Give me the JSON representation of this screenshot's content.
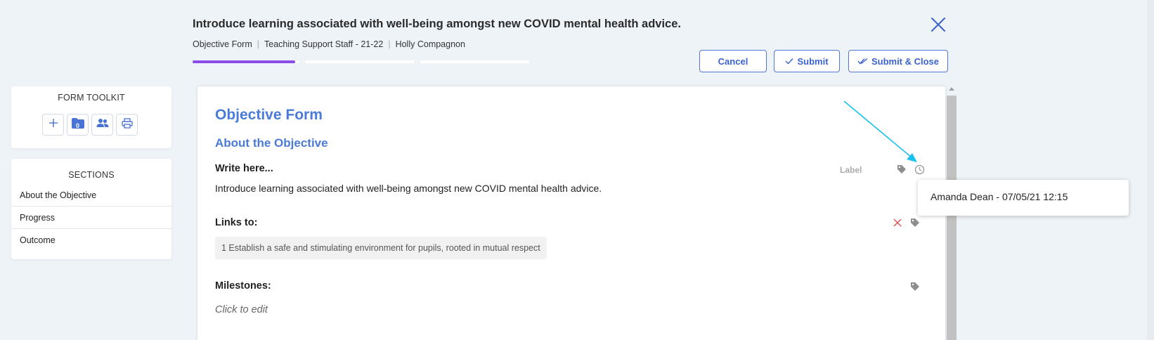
{
  "header": {
    "title": "Introduce learning associated with well-being amongst new COVID mental health advice.",
    "breadcrumb": [
      "Objective Form",
      "Teaching Support Staff - 21-22",
      "Holly Compagnon"
    ],
    "progress": [
      0.96,
      0,
      0
    ],
    "close_icon": "close-icon"
  },
  "actions": {
    "cancel": "Cancel",
    "submit": "Submit",
    "submit_close": "Submit & Close"
  },
  "toolkit": {
    "heading": "FORM TOOLKIT",
    "tools": [
      {
        "icon": "plus-icon"
      },
      {
        "icon": "folder-icon",
        "badge": "0"
      },
      {
        "icon": "people-icon"
      },
      {
        "icon": "print-icon"
      }
    ]
  },
  "sections": {
    "heading": "SECTIONS",
    "items": [
      {
        "label": "About the Objective"
      },
      {
        "label": "Progress"
      },
      {
        "label": "Outcome"
      }
    ]
  },
  "form": {
    "title": "Objective Form",
    "subtitle": "About the Objective",
    "write_label": "Write here...",
    "write_value": "Introduce learning associated with well-being amongst new COVID mental health advice.",
    "label_button": "Label",
    "links_label": "Links to:",
    "link_chip": "1 Establish a safe and stimulating environment for pupils, rooted in mutual respect",
    "milestones_label": "Milestones:",
    "milestones_placeholder": "Click to edit"
  },
  "popover": {
    "text": "Amanda Dean - 07/05/21 12:15"
  },
  "colors": {
    "accent": "#4a7bd9",
    "button_text": "#3b63d0",
    "progress": "#8a4ee8",
    "delete": "#e05555",
    "annotation": "#19c0f0"
  }
}
